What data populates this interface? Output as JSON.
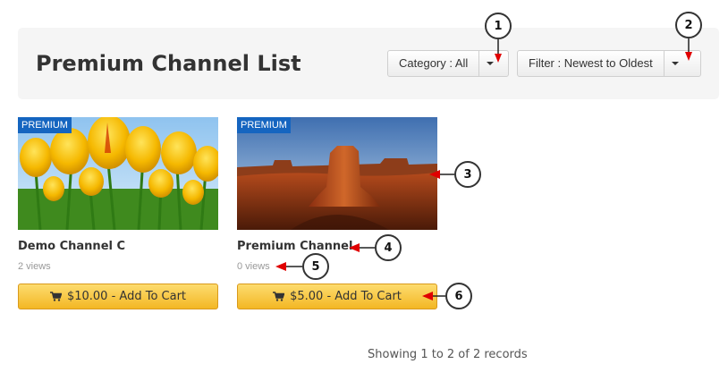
{
  "header": {
    "title": "Premium Channel List",
    "category_label": "Category : All",
    "filter_label": "Filter : Newest to Oldest"
  },
  "channels": [
    {
      "badge": "PREMIUM",
      "title": "Demo Channel C",
      "views": "2 views",
      "cart_label": "$10.00 - Add To Cart",
      "thumbnail": "yellow tulips"
    },
    {
      "badge": "PREMIUM",
      "title": "Premium Channel",
      "views": "0 views",
      "cart_label": "$5.00 - Add To Cart",
      "thumbnail": "desert butte"
    }
  ],
  "footer": {
    "records_text": "Showing 1 to 2 of 2 records"
  },
  "callouts": [
    "1",
    "2",
    "3",
    "4",
    "5",
    "6"
  ],
  "colors": {
    "badge": "#1565c0",
    "cart_button_top": "#fddc6f",
    "cart_button_bottom": "#f3b724",
    "arrow": "#e00000"
  },
  "icons": {
    "cart": "cart-icon",
    "caret": "caret-down-icon"
  }
}
